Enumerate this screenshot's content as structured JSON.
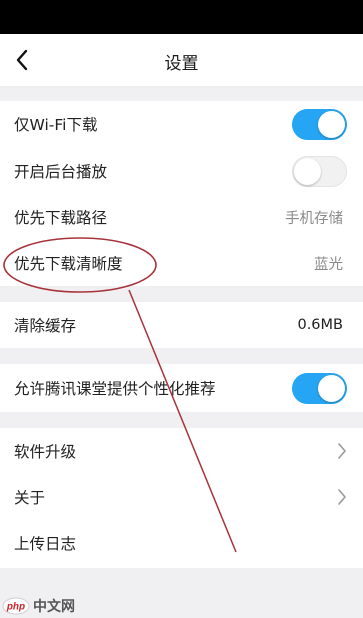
{
  "nav": {
    "title": "设置"
  },
  "rows": {
    "wifi_download": {
      "label": "仅Wi-Fi下载",
      "toggle": "on"
    },
    "background_play": {
      "label": "开启后台播放",
      "toggle": "off"
    },
    "download_path": {
      "label": "优先下载路径",
      "value": "手机存储"
    },
    "download_quality": {
      "label": "优先下载清晰度",
      "value": "蓝光"
    },
    "clear_cache": {
      "label": "清除缓存",
      "value": "0.6MB"
    },
    "personalized": {
      "label": "允许腾讯课堂提供个性化推荐",
      "toggle": "on"
    },
    "software_upgrade": {
      "label": "软件升级"
    },
    "about": {
      "label": "关于"
    },
    "upload_log": {
      "label": "上传日志"
    }
  },
  "watermark": {
    "text": "中文网",
    "logo_text": "php"
  },
  "colors": {
    "toggle_on": "#25a5f3",
    "annotation": "#a8323a",
    "background": "#f0f0f2"
  }
}
